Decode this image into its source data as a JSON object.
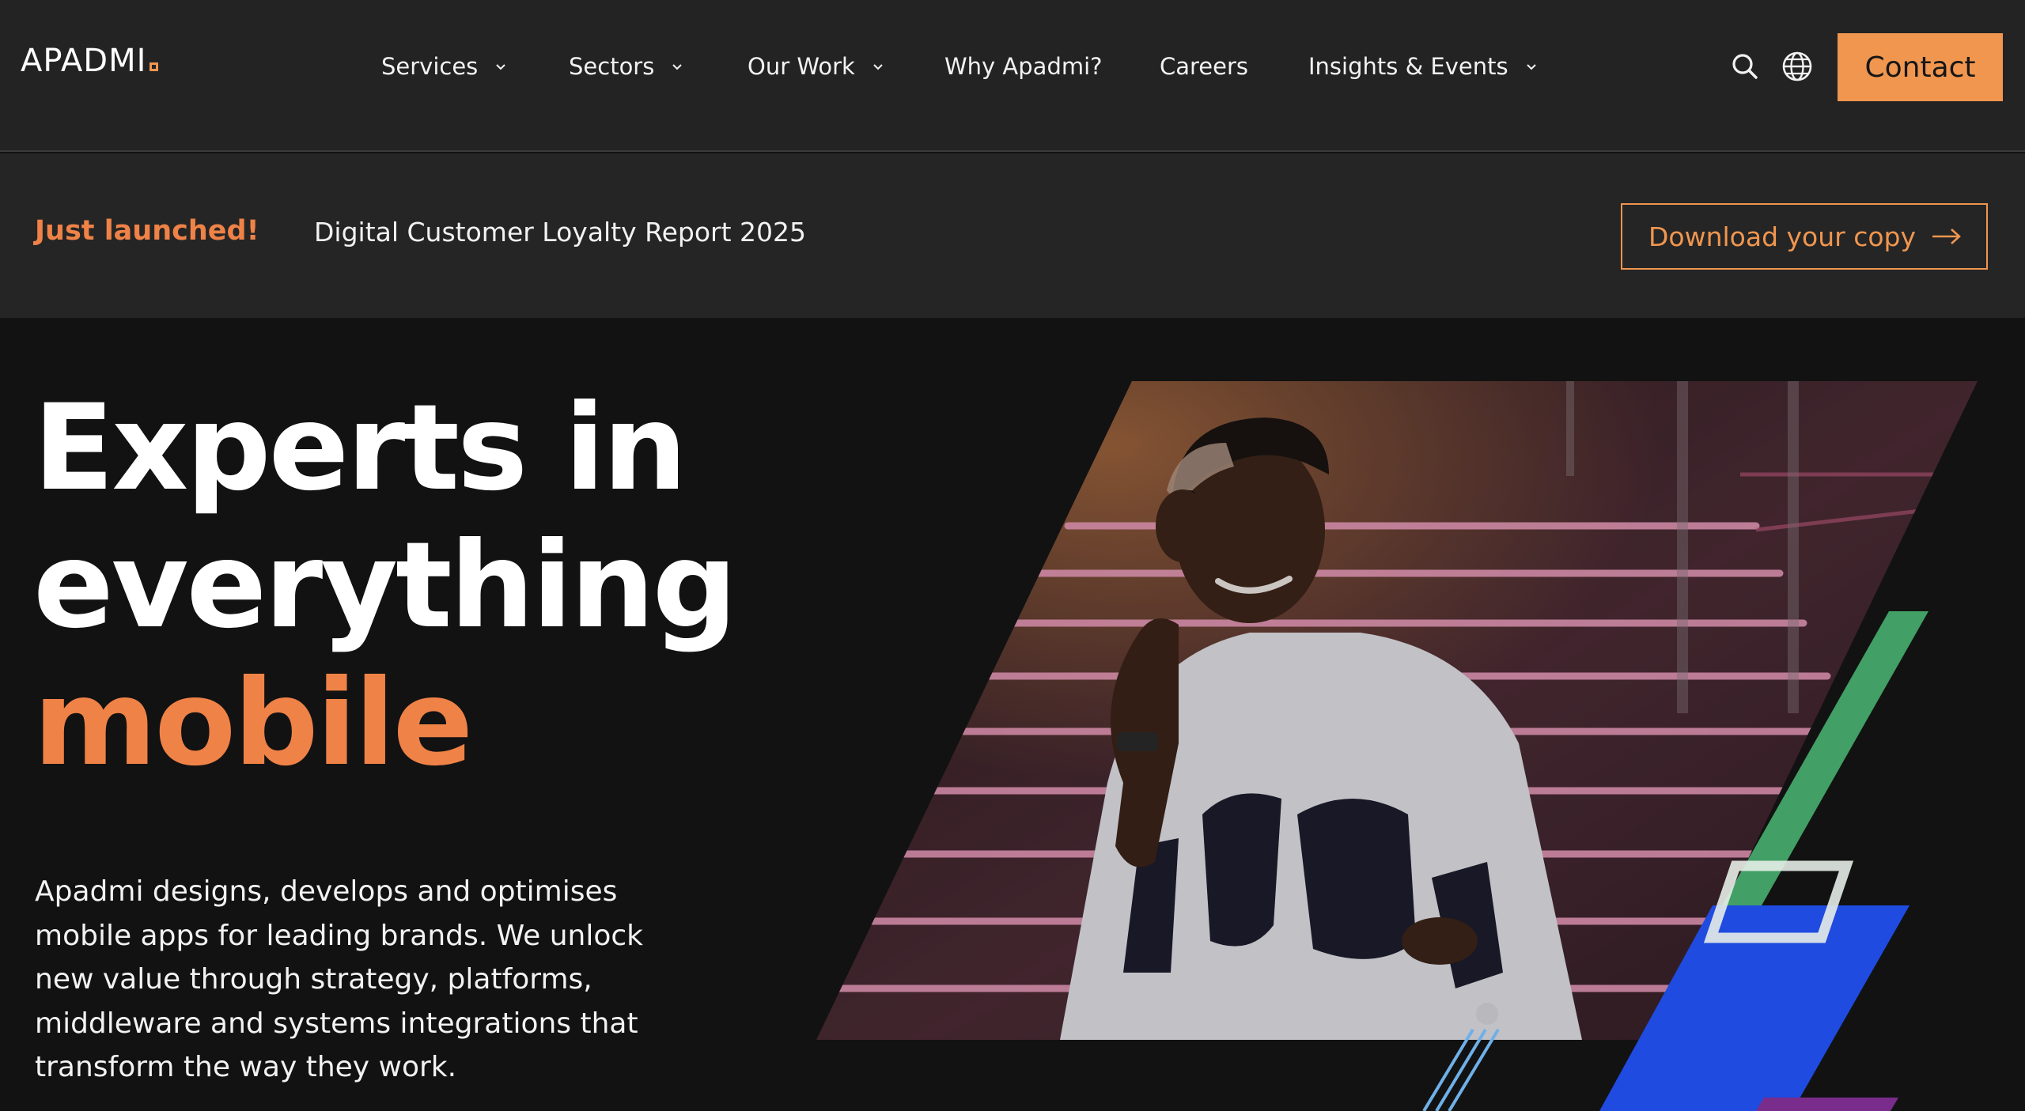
{
  "brand": {
    "logo_text": "APADMI",
    "accent_color": "#f0964f",
    "highlight_color": "#ef8247"
  },
  "nav": {
    "items": [
      {
        "label": "Services",
        "has_dropdown": true
      },
      {
        "label": "Sectors",
        "has_dropdown": true
      },
      {
        "label": "Our Work",
        "has_dropdown": true
      },
      {
        "label": "Why Apadmi?",
        "has_dropdown": false
      },
      {
        "label": "Careers",
        "has_dropdown": false
      },
      {
        "label": "Insights & Events",
        "has_dropdown": true
      }
    ],
    "search_icon": "search-icon",
    "language_icon": "globe-icon",
    "contact_label": "Contact"
  },
  "announcement": {
    "tag": "Just launched!",
    "text": "Digital Customer Loyalty Report 2025",
    "cta_label": "Download your copy",
    "cta_icon": "arrow-right-icon"
  },
  "hero": {
    "title_line1": "Experts in",
    "title_line2": "everything",
    "title_accent": "mobile",
    "description": "Apadmi designs, develops and optimises mobile apps for leading brands. We unlock new value through strategy, platforms, middleware and systems integrations that transform the way they work.",
    "image_subject": "man-on-phone-on-stairs-photo",
    "shape_colors": {
      "green": "#46a86a",
      "blue": "#1f4be0",
      "light_blue": "#6fb0e8",
      "purple": "#7a2c8c"
    }
  }
}
